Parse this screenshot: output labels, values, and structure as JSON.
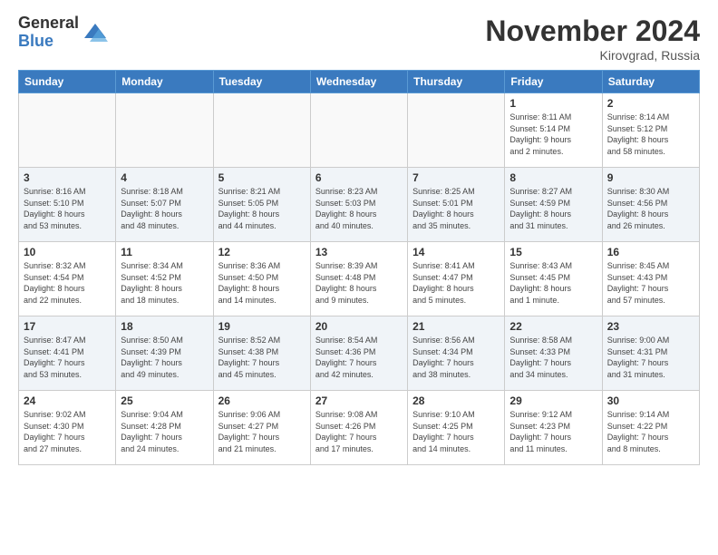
{
  "logo": {
    "general": "General",
    "blue": "Blue"
  },
  "header": {
    "title": "November 2024",
    "location": "Kirovgrad, Russia"
  },
  "weekdays": [
    "Sunday",
    "Monday",
    "Tuesday",
    "Wednesday",
    "Thursday",
    "Friday",
    "Saturday"
  ],
  "weeks": [
    [
      {
        "day": "",
        "info": ""
      },
      {
        "day": "",
        "info": ""
      },
      {
        "day": "",
        "info": ""
      },
      {
        "day": "",
        "info": ""
      },
      {
        "day": "",
        "info": ""
      },
      {
        "day": "1",
        "info": "Sunrise: 8:11 AM\nSunset: 5:14 PM\nDaylight: 9 hours\nand 2 minutes."
      },
      {
        "day": "2",
        "info": "Sunrise: 8:14 AM\nSunset: 5:12 PM\nDaylight: 8 hours\nand 58 minutes."
      }
    ],
    [
      {
        "day": "3",
        "info": "Sunrise: 8:16 AM\nSunset: 5:10 PM\nDaylight: 8 hours\nand 53 minutes."
      },
      {
        "day": "4",
        "info": "Sunrise: 8:18 AM\nSunset: 5:07 PM\nDaylight: 8 hours\nand 48 minutes."
      },
      {
        "day": "5",
        "info": "Sunrise: 8:21 AM\nSunset: 5:05 PM\nDaylight: 8 hours\nand 44 minutes."
      },
      {
        "day": "6",
        "info": "Sunrise: 8:23 AM\nSunset: 5:03 PM\nDaylight: 8 hours\nand 40 minutes."
      },
      {
        "day": "7",
        "info": "Sunrise: 8:25 AM\nSunset: 5:01 PM\nDaylight: 8 hours\nand 35 minutes."
      },
      {
        "day": "8",
        "info": "Sunrise: 8:27 AM\nSunset: 4:59 PM\nDaylight: 8 hours\nand 31 minutes."
      },
      {
        "day": "9",
        "info": "Sunrise: 8:30 AM\nSunset: 4:56 PM\nDaylight: 8 hours\nand 26 minutes."
      }
    ],
    [
      {
        "day": "10",
        "info": "Sunrise: 8:32 AM\nSunset: 4:54 PM\nDaylight: 8 hours\nand 22 minutes."
      },
      {
        "day": "11",
        "info": "Sunrise: 8:34 AM\nSunset: 4:52 PM\nDaylight: 8 hours\nand 18 minutes."
      },
      {
        "day": "12",
        "info": "Sunrise: 8:36 AM\nSunset: 4:50 PM\nDaylight: 8 hours\nand 14 minutes."
      },
      {
        "day": "13",
        "info": "Sunrise: 8:39 AM\nSunset: 4:48 PM\nDaylight: 8 hours\nand 9 minutes."
      },
      {
        "day": "14",
        "info": "Sunrise: 8:41 AM\nSunset: 4:47 PM\nDaylight: 8 hours\nand 5 minutes."
      },
      {
        "day": "15",
        "info": "Sunrise: 8:43 AM\nSunset: 4:45 PM\nDaylight: 8 hours\nand 1 minute."
      },
      {
        "day": "16",
        "info": "Sunrise: 8:45 AM\nSunset: 4:43 PM\nDaylight: 7 hours\nand 57 minutes."
      }
    ],
    [
      {
        "day": "17",
        "info": "Sunrise: 8:47 AM\nSunset: 4:41 PM\nDaylight: 7 hours\nand 53 minutes."
      },
      {
        "day": "18",
        "info": "Sunrise: 8:50 AM\nSunset: 4:39 PM\nDaylight: 7 hours\nand 49 minutes."
      },
      {
        "day": "19",
        "info": "Sunrise: 8:52 AM\nSunset: 4:38 PM\nDaylight: 7 hours\nand 45 minutes."
      },
      {
        "day": "20",
        "info": "Sunrise: 8:54 AM\nSunset: 4:36 PM\nDaylight: 7 hours\nand 42 minutes."
      },
      {
        "day": "21",
        "info": "Sunrise: 8:56 AM\nSunset: 4:34 PM\nDaylight: 7 hours\nand 38 minutes."
      },
      {
        "day": "22",
        "info": "Sunrise: 8:58 AM\nSunset: 4:33 PM\nDaylight: 7 hours\nand 34 minutes."
      },
      {
        "day": "23",
        "info": "Sunrise: 9:00 AM\nSunset: 4:31 PM\nDaylight: 7 hours\nand 31 minutes."
      }
    ],
    [
      {
        "day": "24",
        "info": "Sunrise: 9:02 AM\nSunset: 4:30 PM\nDaylight: 7 hours\nand 27 minutes."
      },
      {
        "day": "25",
        "info": "Sunrise: 9:04 AM\nSunset: 4:28 PM\nDaylight: 7 hours\nand 24 minutes."
      },
      {
        "day": "26",
        "info": "Sunrise: 9:06 AM\nSunset: 4:27 PM\nDaylight: 7 hours\nand 21 minutes."
      },
      {
        "day": "27",
        "info": "Sunrise: 9:08 AM\nSunset: 4:26 PM\nDaylight: 7 hours\nand 17 minutes."
      },
      {
        "day": "28",
        "info": "Sunrise: 9:10 AM\nSunset: 4:25 PM\nDaylight: 7 hours\nand 14 minutes."
      },
      {
        "day": "29",
        "info": "Sunrise: 9:12 AM\nSunset: 4:23 PM\nDaylight: 7 hours\nand 11 minutes."
      },
      {
        "day": "30",
        "info": "Sunrise: 9:14 AM\nSunset: 4:22 PM\nDaylight: 7 hours\nand 8 minutes."
      }
    ]
  ]
}
